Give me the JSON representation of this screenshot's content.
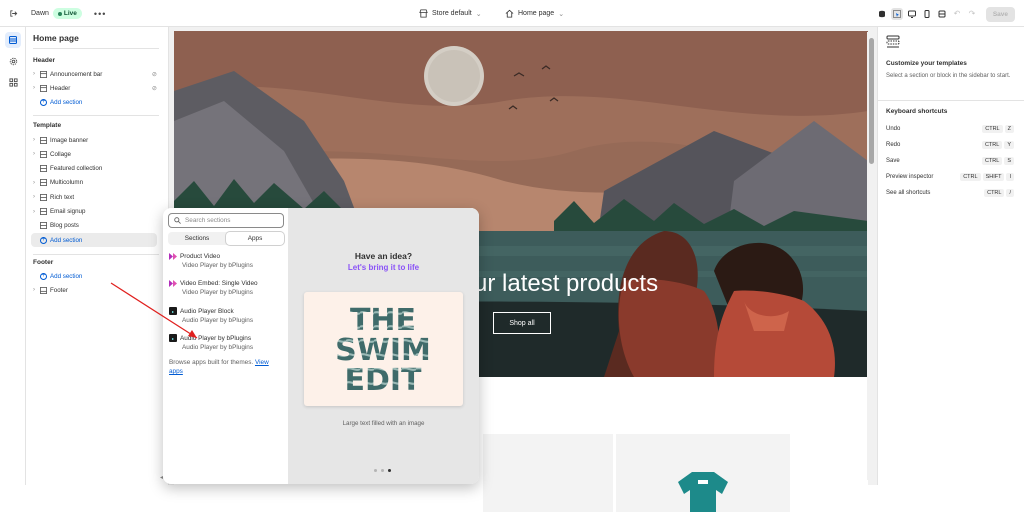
{
  "topbar": {
    "store_name": "Dawn",
    "status": "Live",
    "store_selector": "Store default",
    "page_selector": "Home page",
    "save_label": "Save"
  },
  "sidebar": {
    "title": "Home page",
    "header_group": {
      "label": "Header",
      "items": [
        "Announcement bar",
        "Header"
      ],
      "add_label": "Add section"
    },
    "template_group": {
      "label": "Template",
      "items": [
        "Image banner",
        "Collage",
        "Featured collection",
        "Multicolumn",
        "Rich text",
        "Email signup",
        "Blog posts"
      ],
      "add_label": "Add section"
    },
    "footer_group": {
      "label": "Footer",
      "add_label": "Add section",
      "items": [
        "Footer"
      ]
    }
  },
  "preview": {
    "banner_heading": "ur latest products",
    "shop_button": "Shop all"
  },
  "right_panel": {
    "title": "Customize your templates",
    "description": "Select a section or block in the sidebar to start.",
    "shortcuts_title": "Keyboard shortcuts",
    "shortcuts": [
      {
        "label": "Undo",
        "keys": [
          "CTRL",
          "Z"
        ]
      },
      {
        "label": "Redo",
        "keys": [
          "CTRL",
          "Y"
        ]
      },
      {
        "label": "Save",
        "keys": [
          "CTRL",
          "S"
        ]
      },
      {
        "label": "Preview inspector",
        "keys": [
          "CTRL",
          "SHIFT",
          "I"
        ]
      },
      {
        "label": "See all shortcuts",
        "keys": [
          "CTRL",
          "/"
        ]
      }
    ]
  },
  "picker": {
    "search_placeholder": "Search sections",
    "tabs": [
      "Sections",
      "Apps"
    ],
    "active_tab": "Apps",
    "apps": [
      {
        "name": "Product Video",
        "vendor": "Video Player by bPlugins",
        "icon": "video-player-logo"
      },
      {
        "name": "Video Embed: Single Video",
        "vendor": "Video Player by bPlugins",
        "icon": "video-player-logo"
      },
      {
        "name": "Audio Player Block",
        "vendor": "Audio Player by bPlugins",
        "icon": "audio-player-logo"
      },
      {
        "name": "Audio Player by bPlugins",
        "vendor": "Audio Player by bPlugins",
        "icon": "audio-player-logo"
      }
    ],
    "browse_text": "Browse apps built for themes.",
    "browse_link": "View apps",
    "idea_title": "Have an idea?",
    "idea_link": "Let's bring it to life",
    "card_lines": [
      "THE",
      "SWIM",
      "EDIT"
    ],
    "card_caption": "Large text filled with an image",
    "page_dots": 3,
    "active_dot": 3
  },
  "colors": {
    "live_bg": "#cdfee1",
    "link": "#005bd3",
    "idea_link": "#8a52f7",
    "annotation_arrow": "#e0201e"
  }
}
